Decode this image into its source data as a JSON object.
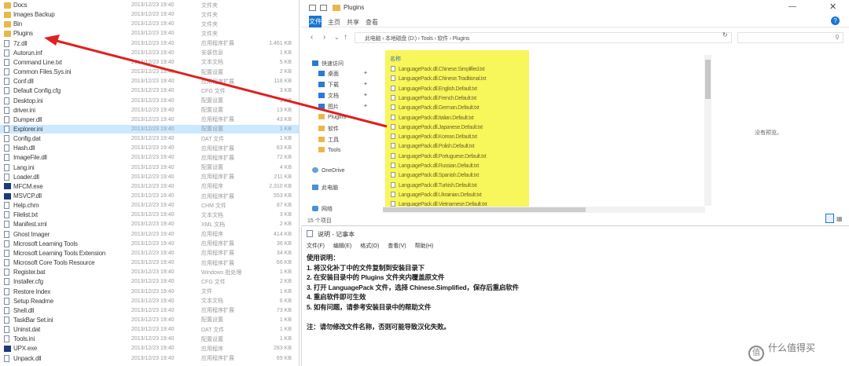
{
  "left_list": {
    "files": [
      {
        "name": "Docs",
        "date": "2013/12/23 19:40",
        "type": "文件夹",
        "size": "",
        "kind": "folder"
      },
      {
        "name": "Images Backup",
        "date": "2013/12/23 19:40",
        "type": "文件夹",
        "size": "",
        "kind": "folder"
      },
      {
        "name": "Bin",
        "date": "2013/12/23 19:40",
        "type": "文件夹",
        "size": "",
        "kind": "folder"
      },
      {
        "name": "Plugins",
        "date": "2013/12/23 19:40",
        "type": "文件夹",
        "size": "",
        "kind": "folder"
      },
      {
        "name": "7z.dll",
        "date": "2013/12/23 19:40",
        "type": "应用程序扩展",
        "size": "1,461 KB",
        "kind": "file"
      },
      {
        "name": "Autorun.inf",
        "date": "2013/12/23 19:40",
        "type": "安装信息",
        "size": "1 KB",
        "kind": "file"
      },
      {
        "name": "Command Line.txt",
        "date": "2013/12/23 19:40",
        "type": "文本文档",
        "size": "5 KB",
        "kind": "file"
      },
      {
        "name": "Common Files.Sys.ini",
        "date": "2013/12/23 19:40",
        "type": "配置设置",
        "size": "2 KB",
        "kind": "file"
      },
      {
        "name": "Conf.dll",
        "date": "2013/12/23 19:40",
        "type": "应用程序扩展",
        "size": "118 KB",
        "kind": "file"
      },
      {
        "name": "Default Config.cfg",
        "date": "2013/12/23 19:40",
        "type": "CFG 文件",
        "size": "3 KB",
        "kind": "file"
      },
      {
        "name": "Desktop.ini",
        "date": "2013/12/23 19:40",
        "type": "配置设置",
        "size": "1 KB",
        "kind": "file"
      },
      {
        "name": "driver.ini",
        "date": "2013/12/23 19:40",
        "type": "配置设置",
        "size": "13 KB",
        "kind": "file"
      },
      {
        "name": "Dumper.dll",
        "date": "2013/12/23 19:40",
        "type": "应用程序扩展",
        "size": "43 KB",
        "kind": "file"
      },
      {
        "name": "Explorer.ini",
        "date": "2013/12/23 19:40",
        "type": "配置设置",
        "size": "1 KB",
        "kind": "file"
      },
      {
        "name": "Config.dat",
        "date": "2013/12/23 19:40",
        "type": "DAT 文件",
        "size": "1 KB",
        "kind": "file"
      },
      {
        "name": "Hash.dll",
        "date": "2013/12/23 19:40",
        "type": "应用程序扩展",
        "size": "63 KB",
        "kind": "file"
      },
      {
        "name": "ImageFile.dll",
        "date": "2013/12/23 19:40",
        "type": "应用程序扩展",
        "size": "72 KB",
        "kind": "file"
      },
      {
        "name": "Lang.ini",
        "date": "2013/12/23 19:40",
        "type": "配置设置",
        "size": "4 KB",
        "kind": "file"
      },
      {
        "name": "Loader.dll",
        "date": "2013/12/23 19:40",
        "type": "应用程序扩展",
        "size": "211 KB",
        "kind": "file"
      },
      {
        "name": "MFCM.exe",
        "date": "2013/12/23 19:40",
        "type": "应用程序",
        "size": "2,310 KB",
        "kind": "dark"
      },
      {
        "name": "MSVCP.dll",
        "date": "2013/12/23 19:40",
        "type": "应用程序扩展",
        "size": "553 KB",
        "kind": "dark"
      },
      {
        "name": "Help.chm",
        "date": "2013/12/23 19:40",
        "type": "CHM 文件",
        "size": "87 KB",
        "kind": "file"
      },
      {
        "name": "Filelist.txt",
        "date": "2013/12/23 19:40",
        "type": "文本文档",
        "size": "3 KB",
        "kind": "file"
      },
      {
        "name": "Manifest.xml",
        "date": "2013/12/23 19:40",
        "type": "XML 文档",
        "size": "2 KB",
        "kind": "file"
      },
      {
        "name": "Ghost Imager",
        "date": "2013/12/23 19:40",
        "type": "应用程序",
        "size": "414 KB",
        "kind": "file"
      },
      {
        "name": "Microsoft Learning Tools",
        "date": "2013/12/23 19:40",
        "type": "应用程序扩展",
        "size": "36 KB",
        "kind": "file"
      },
      {
        "name": "Microsoft Learning Tools Extension",
        "date": "2013/12/23 19:40",
        "type": "应用程序扩展",
        "size": "34 KB",
        "kind": "file"
      },
      {
        "name": "Microsoft Core Tools Resource",
        "date": "2013/12/23 19:40",
        "type": "应用程序扩展",
        "size": "66 KB",
        "kind": "file"
      },
      {
        "name": "Register.bat",
        "date": "2013/12/23 19:40",
        "type": "Windows 批处理",
        "size": "1 KB",
        "kind": "file"
      },
      {
        "name": "Installer.cfg",
        "date": "2013/12/23 19:40",
        "type": "CFG 文件",
        "size": "2 KB",
        "kind": "file"
      },
      {
        "name": "Restore Index",
        "date": "2013/12/23 19:40",
        "type": "文件",
        "size": "1 KB",
        "kind": "file"
      },
      {
        "name": "Setup Readme",
        "date": "2013/12/23 19:40",
        "type": "文本文档",
        "size": "6 KB",
        "kind": "file"
      },
      {
        "name": "Shell.dll",
        "date": "2013/12/23 19:40",
        "type": "应用程序扩展",
        "size": "73 KB",
        "kind": "file"
      },
      {
        "name": "TaskBar Set.ini",
        "date": "2013/12/23 19:40",
        "type": "配置设置",
        "size": "1 KB",
        "kind": "file"
      },
      {
        "name": "Uninst.dat",
        "date": "2013/12/23 19:40",
        "type": "DAT 文件",
        "size": "1 KB",
        "kind": "file"
      },
      {
        "name": "Tools.ini",
        "date": "2013/12/23 19:40",
        "type": "配置设置",
        "size": "1 KB",
        "kind": "file"
      },
      {
        "name": "UPX.exe",
        "date": "2013/12/23 19:40",
        "type": "应用程序",
        "size": "283 KB",
        "kind": "dark"
      },
      {
        "name": "Unpack.dll",
        "date": "2013/12/23 19:40",
        "type": "应用程序扩展",
        "size": "69 KB",
        "kind": "file"
      }
    ]
  },
  "explorer": {
    "title": "Plugins",
    "ribbon": {
      "file": "文件",
      "tabs": [
        "主页",
        "共享",
        "查看"
      ],
      "help": "?"
    },
    "address": "此电脑 › 本地磁盘 (D:) › Tools › 软件 › Plugins",
    "nav_items": [
      {
        "label": "快速访问",
        "icon": "quick-access-icon",
        "kind": "q"
      },
      {
        "label": "桌面",
        "icon": "desktop-icon",
        "kind": "q"
      },
      {
        "label": "下载",
        "icon": "download-icon",
        "kind": "q"
      },
      {
        "label": "文档",
        "icon": "documents-icon",
        "kind": "q"
      },
      {
        "label": "图片",
        "icon": "pictures-icon",
        "kind": "q"
      },
      {
        "label": "Plugins",
        "icon": "folder-icon",
        "kind": "f"
      },
      {
        "label": "软件",
        "icon": "folder-icon",
        "kind": "f"
      },
      {
        "label": "工具",
        "icon": "folder-icon",
        "kind": "f"
      },
      {
        "label": "Tools",
        "icon": "folder-icon",
        "kind": "f"
      },
      {
        "label": "OneDrive",
        "icon": "cloud-icon",
        "kind": "c"
      },
      {
        "label": "此电脑",
        "icon": "this-pc-icon",
        "kind": "pc"
      },
      {
        "label": "网络",
        "icon": "network-icon",
        "kind": "net"
      }
    ],
    "column_name": "名称",
    "highlighted_files": [
      "LanguagePack.dll.Chinese.Simplified.txt",
      "LanguagePack.dll.Chinese.Traditional.txt",
      "LanguagePack.dll.English.Default.txt",
      "LanguagePack.dll.French.Default.txt",
      "LanguagePack.dll.German.Default.txt",
      "LanguagePack.dll.Italian.Default.txt",
      "LanguagePack.dll.Japanese.Default.txt",
      "LanguagePack.dll.Korean.Default.txt",
      "LanguagePack.dll.Polish.Default.txt",
      "LanguagePack.dll.Portuguese.Default.txt",
      "LanguagePack.dll.Russian.Default.txt",
      "LanguagePack.dll.Spanish.Default.txt",
      "LanguagePack.dll.Turkish.Default.txt",
      "LanguagePack.dll.Ukrainian.Default.txt",
      "LanguagePack.dll.Vietnamese.Default.txt"
    ],
    "preview_message": "没有预览。",
    "status": "15 个项目"
  },
  "notepad": {
    "title": "说明 - 记事本",
    "menu": [
      "文件(F)",
      "编辑(E)",
      "格式(O)",
      "查看(V)",
      "帮助(H)"
    ],
    "lines": [
      "使用说明：",
      "1. 将汉化补丁中的文件复制到安装目录下",
      "2. 在安装目录中的 Plugins 文件夹内覆盖原文件",
      "3. 打开 LanguagePack 文件，选择 Chinese.Simplified，保存后重启软件",
      "4. 重启软件即可生效",
      "5. 如有问题，请参考安装目录中的帮助文件",
      "",
      "注：请勿修改文件名称，否则可能导致汉化失败。"
    ]
  },
  "watermark": {
    "logo": "值",
    "text": "什么值得买"
  },
  "colors": {
    "accent": "#1976d2",
    "highlight": "#f6f43d",
    "arrow": "#e02020",
    "folder": "#e8b84b"
  }
}
